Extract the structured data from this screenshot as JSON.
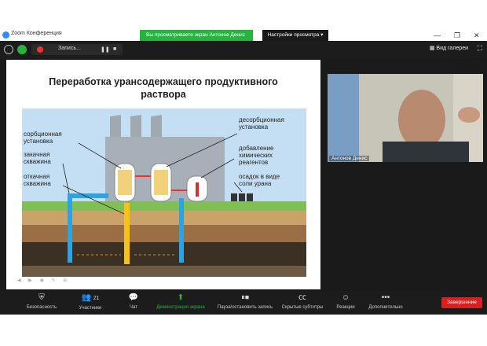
{
  "window": {
    "app_title": "Zoom Конференция",
    "share_banner": "Вы просматриваете экран Антонов Денис",
    "view_options": "Настройки просмотра",
    "minimize": "—",
    "restore": "❐",
    "close": "✕"
  },
  "meeting_bar": {
    "recording_label": "Запись...",
    "pause_icon": "❚❚",
    "stop_icon": "■",
    "gallery_view": "Вид галереи"
  },
  "slide": {
    "title_line1": "Переработка урансодержащего продуктивного",
    "title_line2": "раствора",
    "labels": {
      "sorption_1": "сорбционная",
      "sorption_2": "установка",
      "injection_1": "закачная",
      "injection_2": "скважина",
      "pumping_1": "откачная",
      "pumping_2": "скважина",
      "desorption_1": "десорбционная",
      "desorption_2": "установка",
      "chemicals_1": "добавление",
      "chemicals_2": "химических",
      "chemicals_3": "реагентов",
      "precip_1": "осадок в виде",
      "precip_2": "соли урана"
    },
    "controls": "◀ ▶ ◉ ✎ ⊕"
  },
  "video": {
    "participant_name": "Антонов Денис"
  },
  "toolbar": {
    "security": "Безопасность",
    "participants": "Участники",
    "participants_count": "21",
    "chat": "Чат",
    "share_screen": "Демонстрация экрана",
    "pause_record": "Пауза/остановить запись",
    "subtitles": "Скрытые субтитры",
    "reactions": "Реакции",
    "more": "Дополнительно",
    "end": "Завершение"
  },
  "colors": {
    "share_green": "#26b43f",
    "end_red": "#d92020",
    "dark_bg": "#1c1c1c"
  }
}
